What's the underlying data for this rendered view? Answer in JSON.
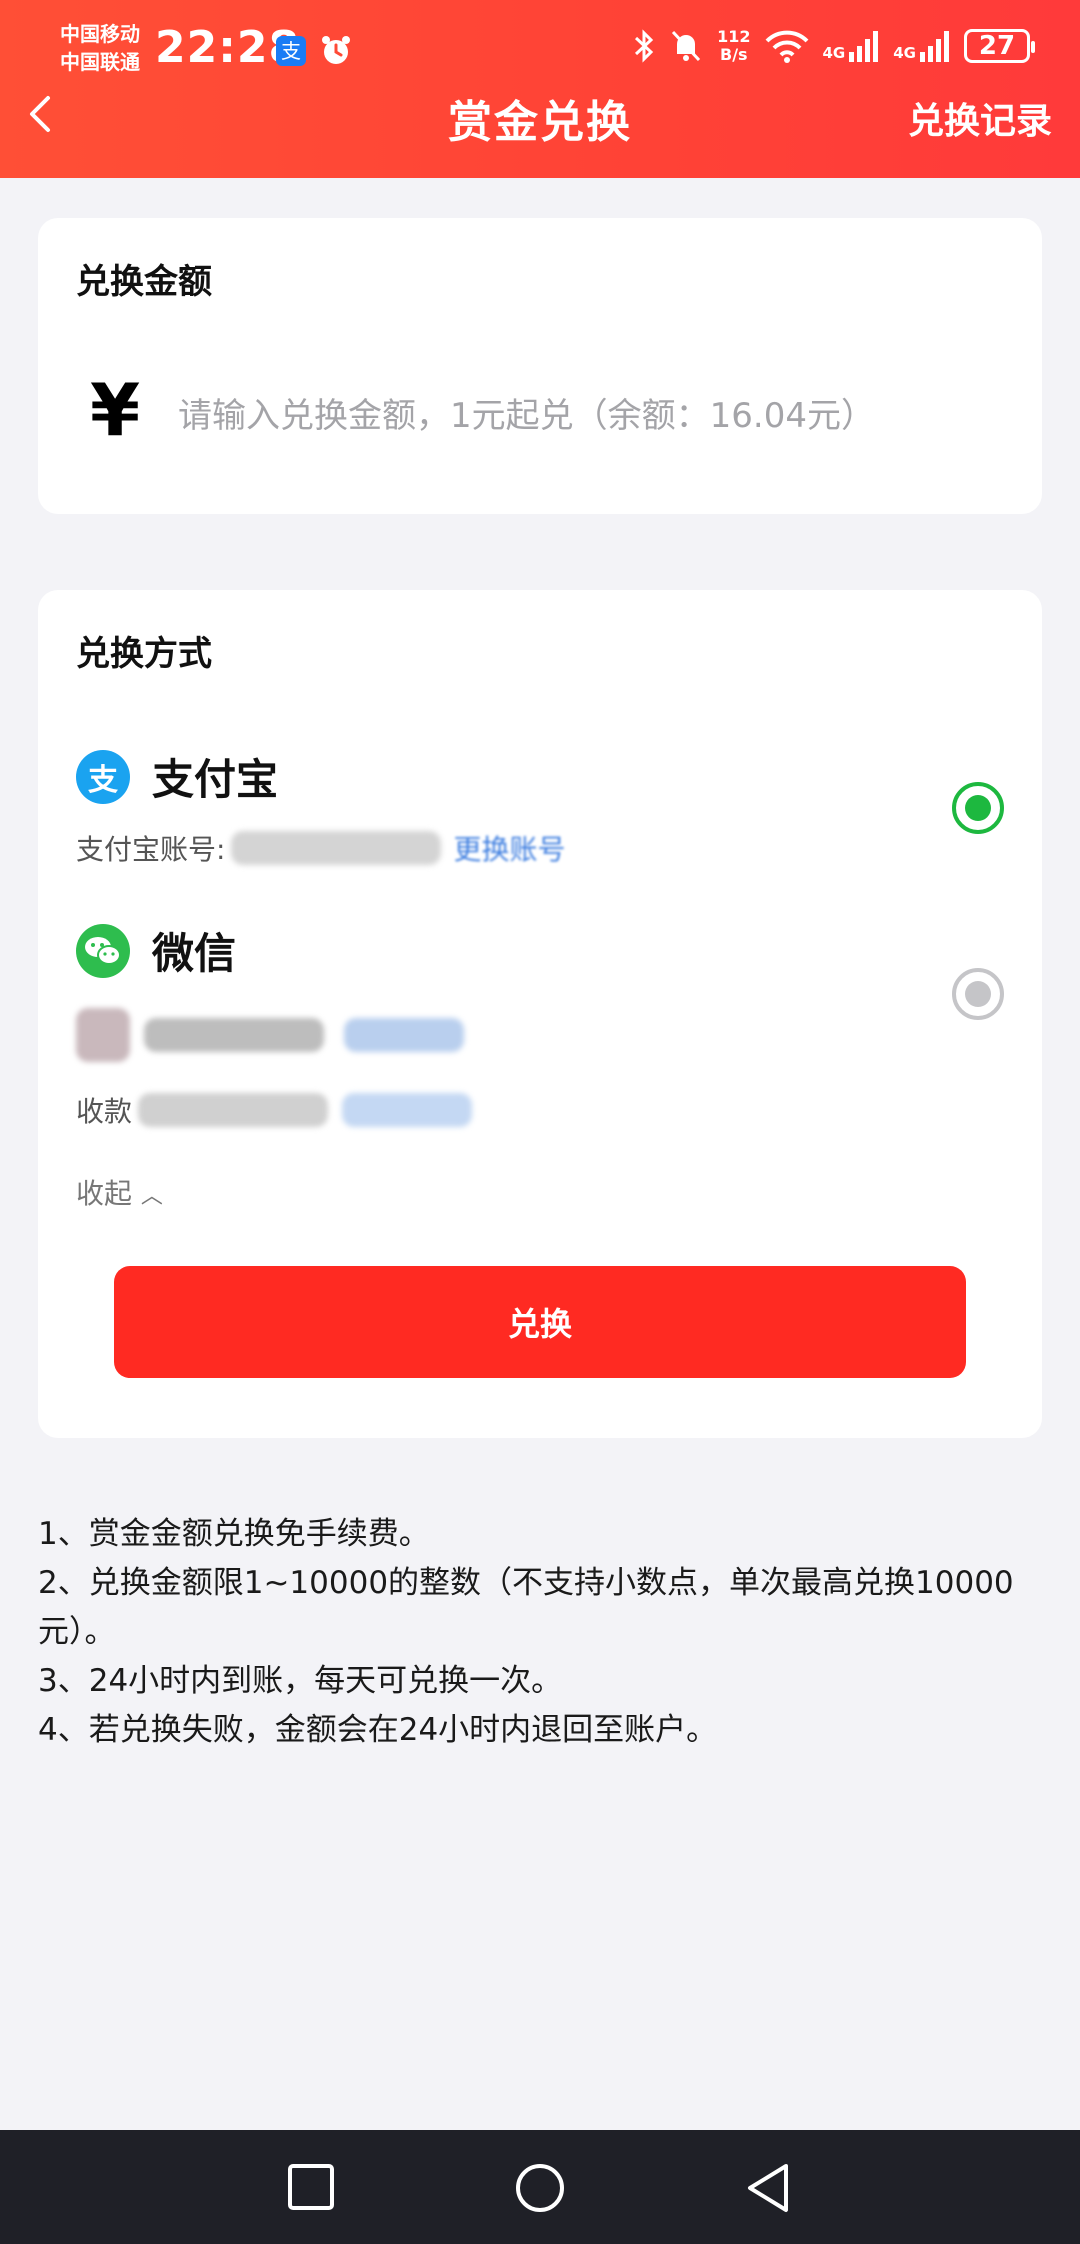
{
  "_value_order": "1 · 2 · … give each value's sequence position",
  "status_bar": {
    "carrier_1": "中国移动",
    "carrier_2": "中国联通",
    "time": "22:28",
    "net_speed_value": "112",
    "net_speed_unit": "B/s",
    "battery": "27",
    "network_1": "4G",
    "network_2": "4G"
  },
  "header": {
    "title": "赏金兑换",
    "right_link": "兑换记录",
    "back_icon": "chevron-left-icon"
  },
  "amount_card": {
    "title": "兑换金额",
    "currency_symbol": "¥",
    "input_placeholder": "请输入兑换金额，1元起兑（余额：16.04元）",
    "input_value": ""
  },
  "method_card": {
    "title": "兑换方式",
    "methods": [
      {
        "name": "支付宝",
        "icon": "alipay-icon",
        "account_label": "支付宝账号:",
        "link": "更换账号",
        "selected": true
      },
      {
        "name": "微信",
        "icon": "wechat-icon",
        "account_label": "收款",
        "selected": false
      }
    ],
    "collapse_label": "收起",
    "submit_label": "兑换"
  },
  "rules": [
    {
      "n": 1,
      "t": "2、兑换金额限1~10000的整数（不支持小数点，单次最高兑换10000元）。"
    },
    {
      "n": 0,
      "t": "1、赏金金额兑换免手续费。"
    },
    {
      "n": 3,
      "t": "4、若兑换失败，金额会在24小时内退回至账户。"
    },
    {
      "n": 2,
      "t": "3、24小时内到账，每天可兑换一次。"
    }
  ],
  "colors": {
    "header": "#ff4236",
    "button": "#ff2a22",
    "radio_selected": "#1db83f",
    "alipay": "#1aa3f0",
    "wechat": "#2ebd4e"
  }
}
